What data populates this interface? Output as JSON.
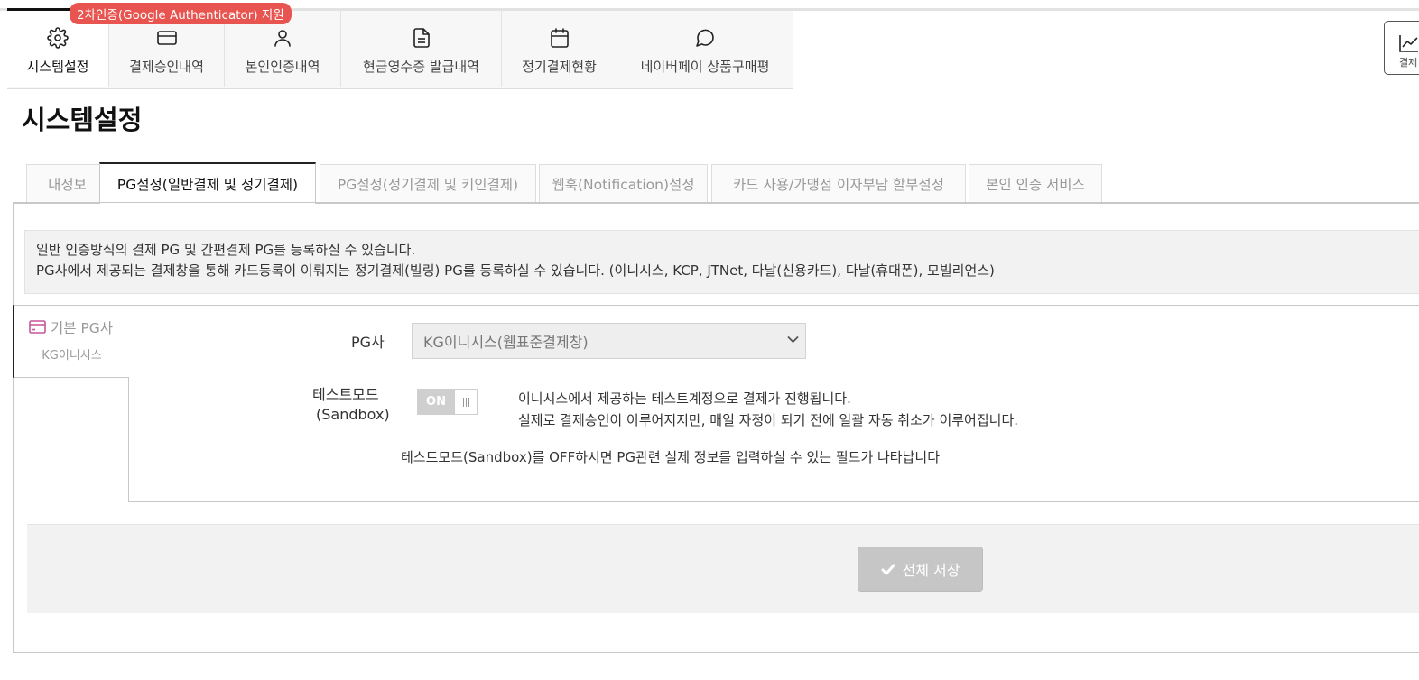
{
  "topnav": {
    "badge": "2차인증(Google Authenticator) 지원",
    "items": [
      {
        "label": "시스템설정",
        "icon": "gear-icon"
      },
      {
        "label": "결제승인내역",
        "icon": "credit-card-icon"
      },
      {
        "label": "본인인증내역",
        "icon": "user-icon"
      },
      {
        "label": "현금영수증 발급내역",
        "icon": "document-icon"
      },
      {
        "label": "정기결제현황",
        "icon": "calendar-icon"
      },
      {
        "label": "네이버페이 상품구매평",
        "icon": "chat-bubble-icon"
      }
    ],
    "stats_label": "결제",
    "stats_icon": "chart-line-icon"
  },
  "page": {
    "title": "시스템설정"
  },
  "tabs": [
    {
      "label": "내정보"
    },
    {
      "label": "PG설정(일반결제 및 정기결제)",
      "active": true
    },
    {
      "label": "PG설정(정기결제 및 키인결제)"
    },
    {
      "label": "웹훅(Notification)설정"
    },
    {
      "label": "카드 사용/가맹점 이자부담 할부설정"
    },
    {
      "label": "본인 인증 서비스"
    }
  ],
  "info": {
    "line1": "일반 인증방식의 결제 PG 및 간편결제 PG를 등록하실 수 있습니다.",
    "line2": "PG사에서 제공되는 결제창을 통해 카드등록이 이뤄지는 정기결제(빌링) PG를 등록하실 수 있습니다. (이니시스, KCP, JTNet, 다날(신용카드), 다날(휴대폰), 모빌리언스)"
  },
  "side_tab": {
    "name": "기본 PG사",
    "sub": "KG이니시스",
    "icon": "credit-card-icon"
  },
  "form": {
    "pg_label": "PG사",
    "pg_value": "KG이니시스(웹표준결제창)",
    "test_label_1": "테스트모드",
    "test_label_2": "(Sandbox)",
    "toggle_text": "ON",
    "desc1": "이니시스에서 제공하는 테스트계정으로 결제가 진행됩니다.",
    "desc2": "실제로 결제승인이 이루어지지만, 매일 자정이 되기 전에 일괄 자동 취소가 이루어집니다.",
    "note": "테스트모드(Sandbox)를 OFF하시면 PG관련 실제 정보를 입력하실 수 있는 필드가 나타납니다"
  },
  "footer": {
    "save_label": "전체 저장"
  },
  "colors": {
    "badge": "#e8544f",
    "side_icon": "#c7549a",
    "save_button": "#c6c6c6"
  }
}
